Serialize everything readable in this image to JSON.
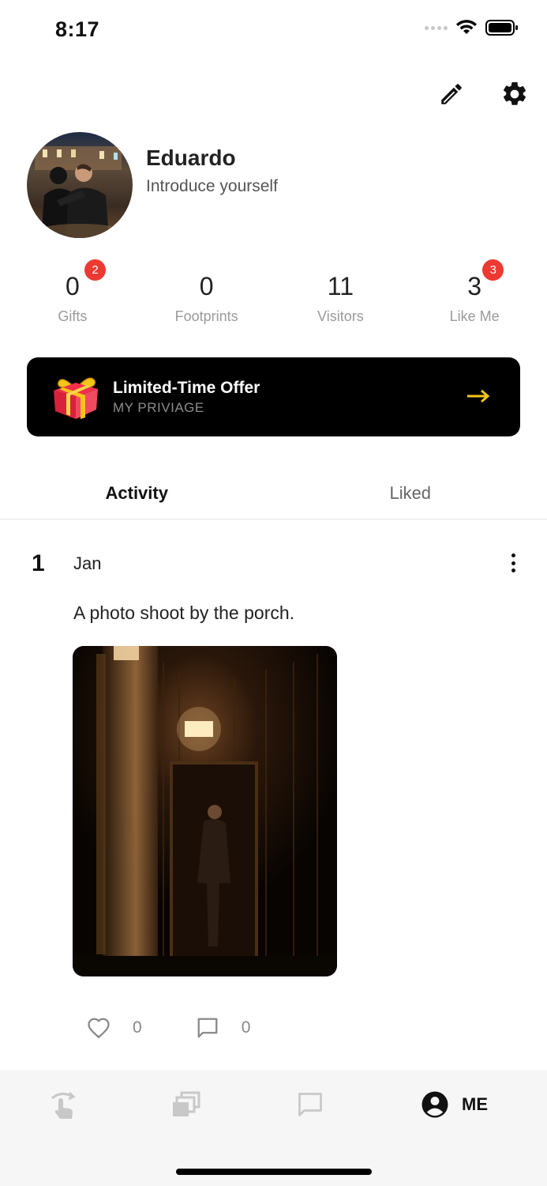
{
  "status_bar": {
    "time": "8:17"
  },
  "header": {
    "edit_icon": "pencil-icon",
    "settings_icon": "gear-icon"
  },
  "profile": {
    "name": "Eduardo",
    "bio": "Introduce yourself"
  },
  "stats": [
    {
      "value": "0",
      "label": "Gifts",
      "badge": "2"
    },
    {
      "value": "0",
      "label": "Footprints",
      "badge": ""
    },
    {
      "value": "11",
      "label": "Visitors",
      "badge": ""
    },
    {
      "value": "3",
      "label": "Like Me",
      "badge": "3"
    }
  ],
  "offer": {
    "title": "Limited-Time Offer",
    "subtitle": "MY PRIVIAGE",
    "arrow": "→",
    "accent": "#f5c518"
  },
  "tabs": [
    {
      "label": "Activity",
      "active": true
    },
    {
      "label": "Liked",
      "active": false
    }
  ],
  "post": {
    "day": "1",
    "month": "Jan",
    "text": "A photo shoot by the porch.",
    "likes": "0",
    "comments": "0"
  },
  "bottom_nav": {
    "me_label": "ME"
  },
  "colors": {
    "badge": "#ec3a32",
    "offer_bg": "#000000",
    "nav_bg": "#f6f6f6"
  }
}
